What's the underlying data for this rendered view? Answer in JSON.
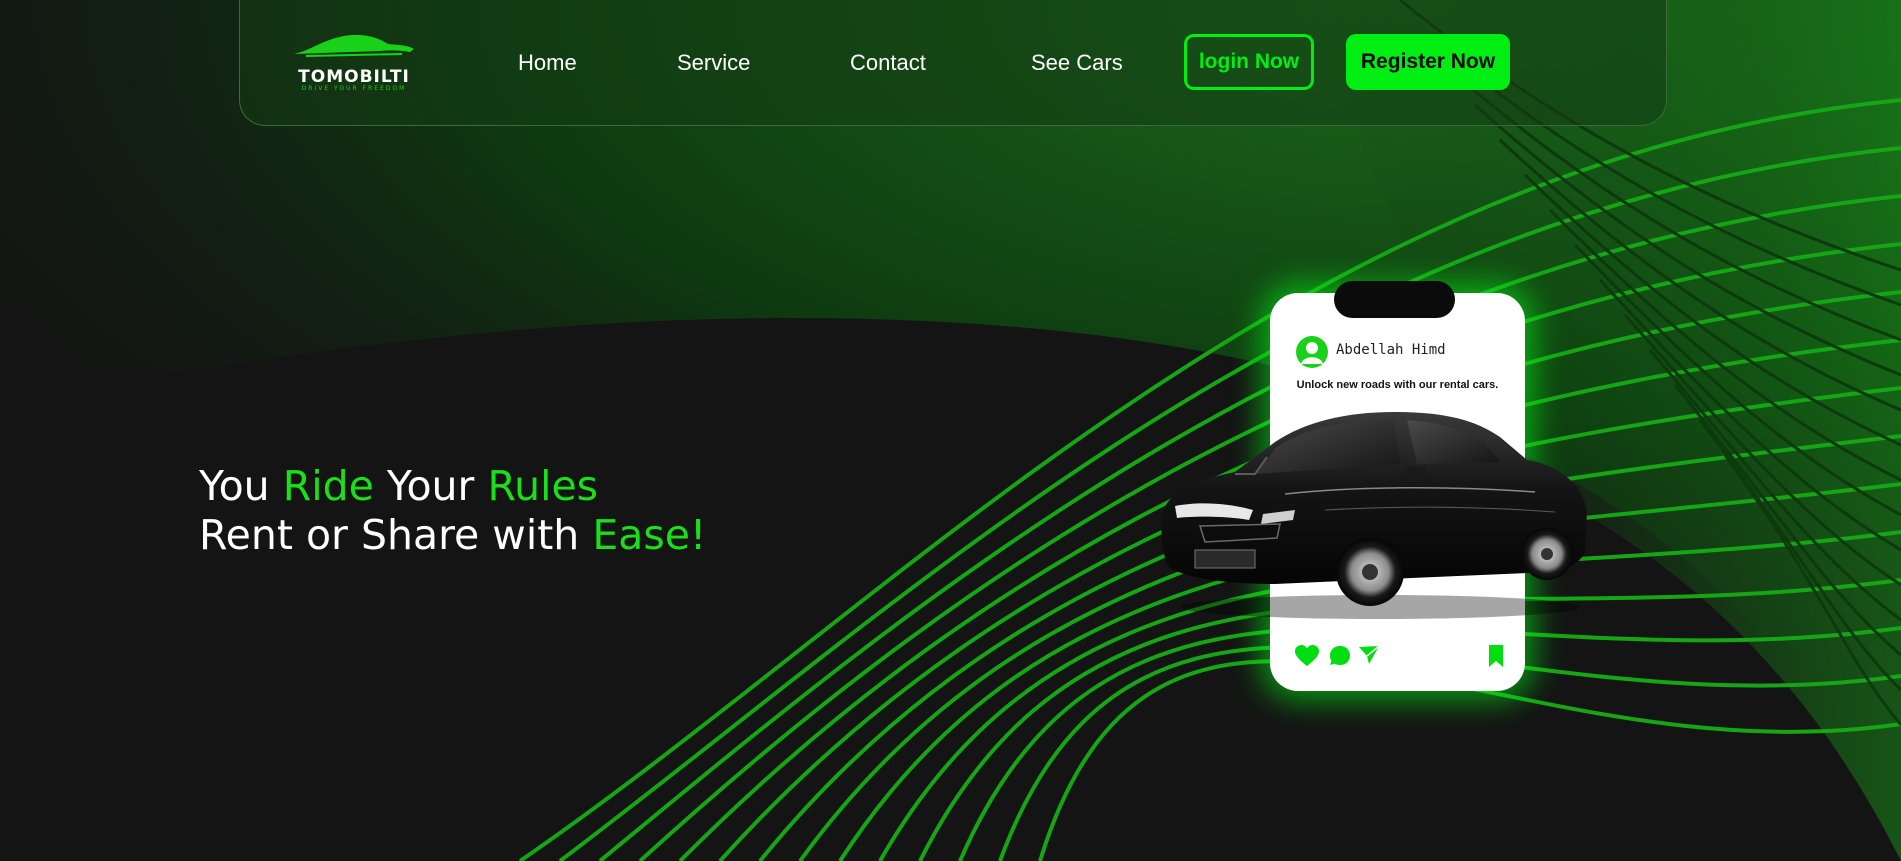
{
  "brand": {
    "name": "TOMOBILTI",
    "tagline": "DRIVE YOUR FREEDOM"
  },
  "nav": {
    "links": [
      "Home",
      "Service",
      "Contact",
      "See Cars"
    ],
    "login_label": "login Now",
    "register_label": "Register Now"
  },
  "hero": {
    "line1": [
      {
        "text": "You ",
        "accent": false
      },
      {
        "text": "Ride",
        "accent": true
      },
      {
        "text": " Your ",
        "accent": false
      },
      {
        "text": "Rules",
        "accent": true
      }
    ],
    "line2": [
      {
        "text": "Rent or Share with ",
        "accent": false
      },
      {
        "text": "Ease!",
        "accent": true
      }
    ]
  },
  "post": {
    "username": "Abdellah Himd",
    "caption": "Unlock new roads with our rental cars.",
    "icons": [
      "heart-icon",
      "comment-icon",
      "send-icon",
      "bookmark-icon"
    ]
  },
  "colors": {
    "accent": "#19e019",
    "button": "#00ee11",
    "background": "#141414"
  }
}
